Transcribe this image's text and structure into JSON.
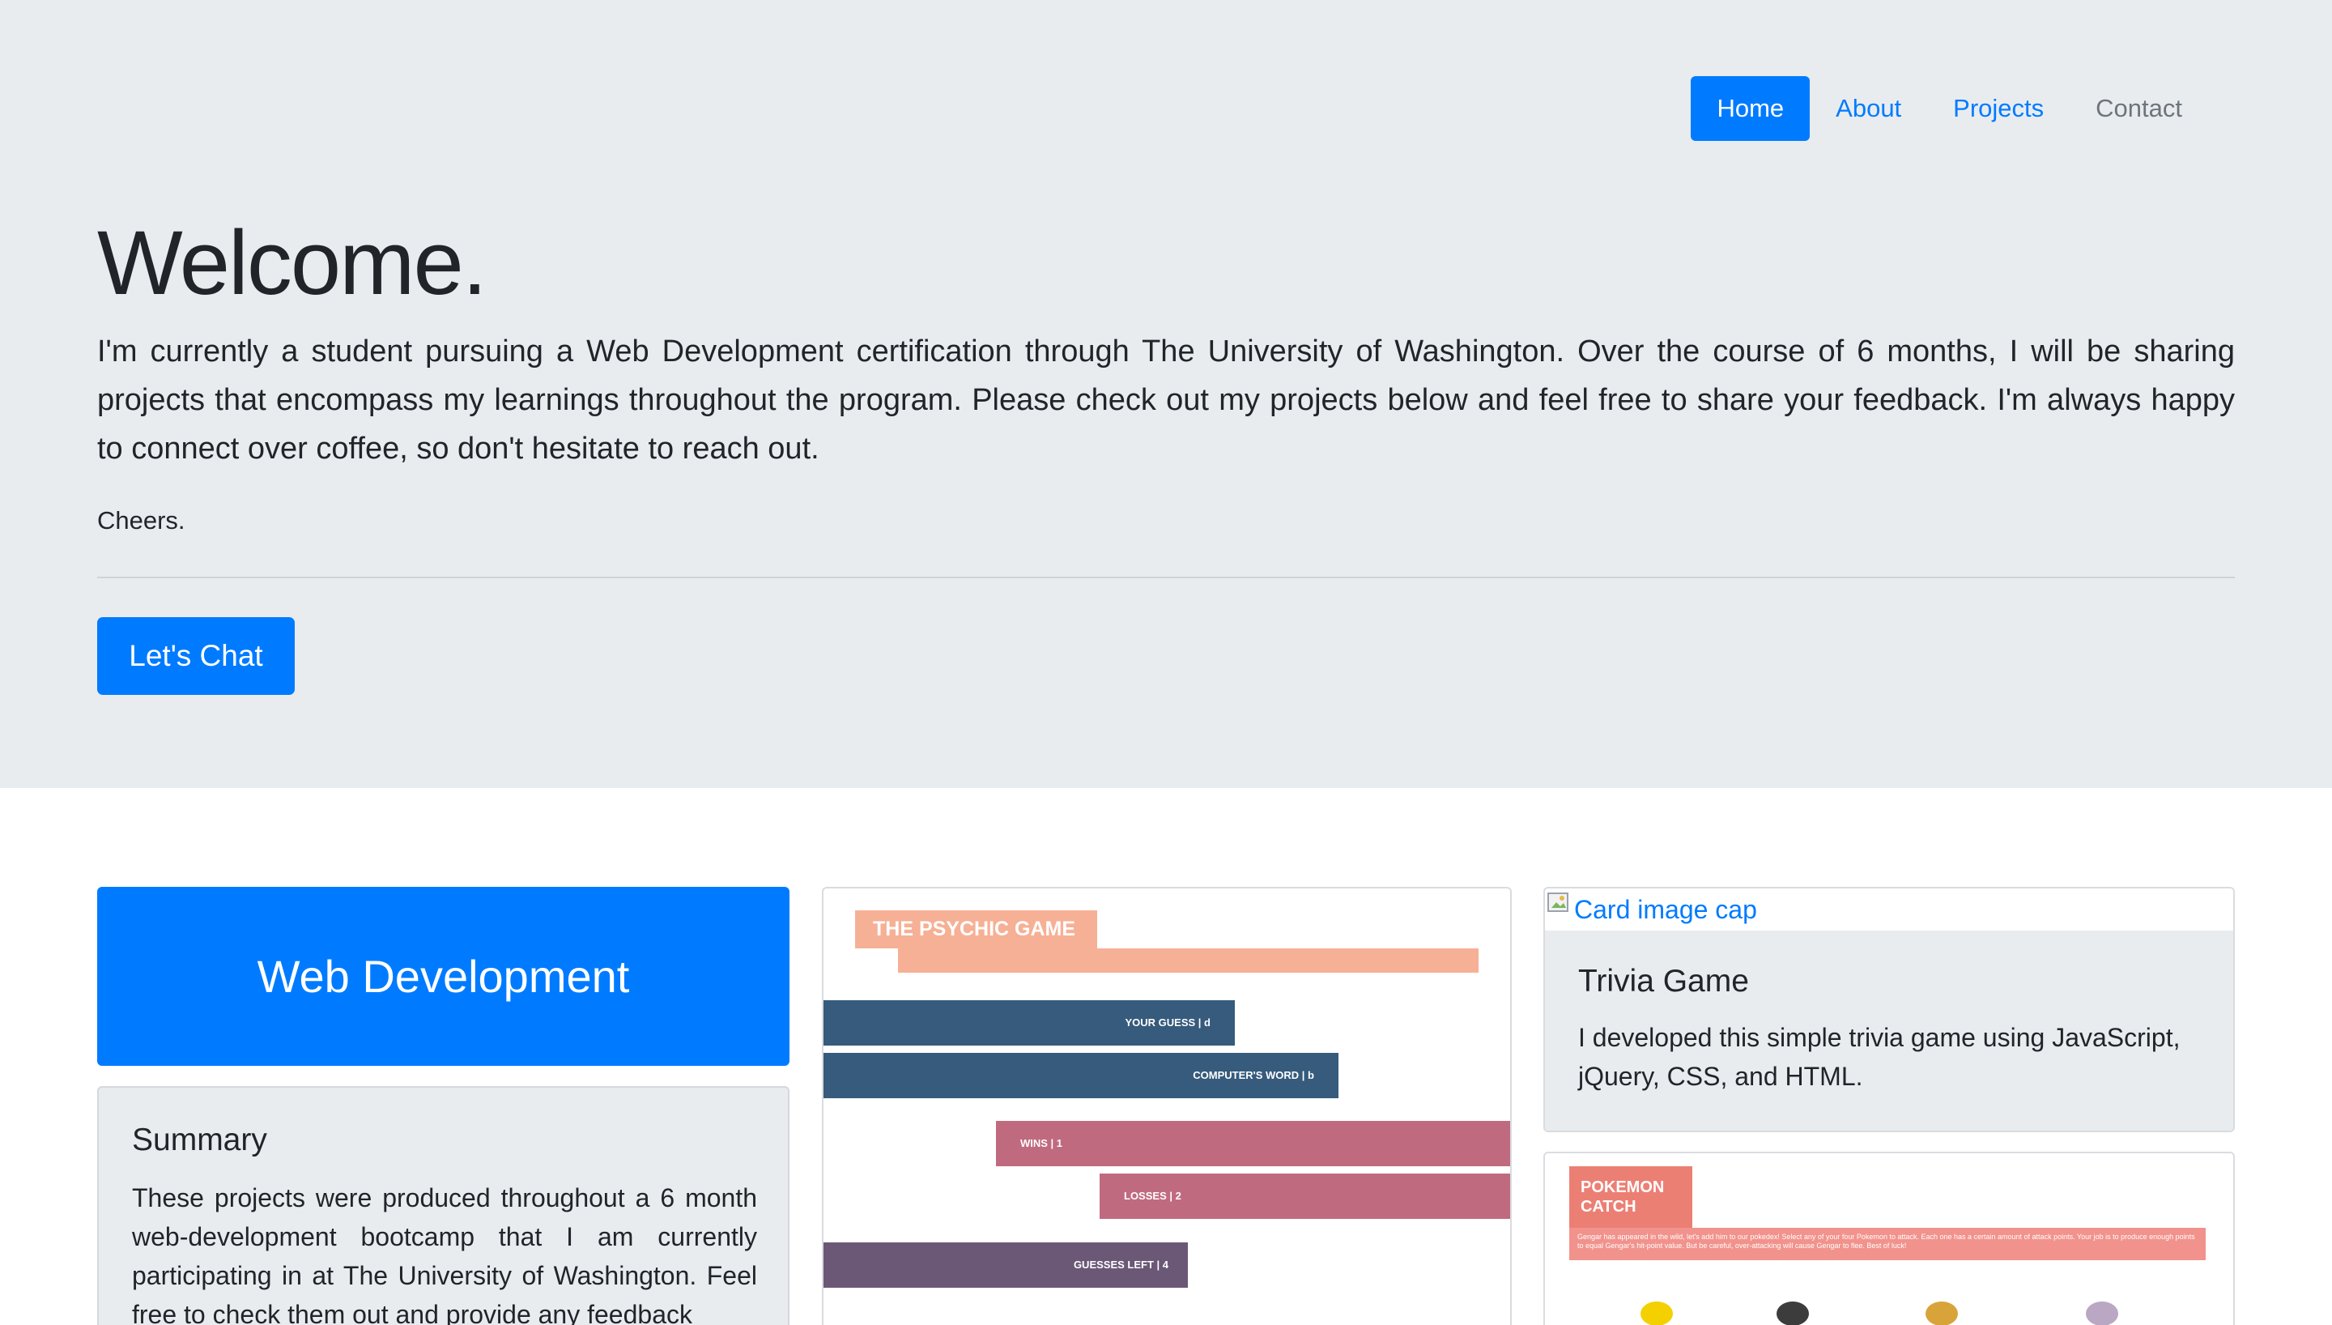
{
  "nav": {
    "items": [
      {
        "label": "Home",
        "active": true
      },
      {
        "label": "About"
      },
      {
        "label": "Projects"
      },
      {
        "label": "Contact"
      }
    ]
  },
  "hero": {
    "heading": "Welcome.",
    "lead": "I'm currently a student pursuing a Web Development certification through The University of Washington. Over the course of 6 months, I will be sharing projects that encompass my learnings throughout the program. Please check out my projects below and feel free to share your feedback. I'm always happy to connect over coffee, so don't hesitate to reach out.",
    "signoff": "Cheers.",
    "cta_label": "Let's Chat"
  },
  "web_dev_card": {
    "title": "Web Development"
  },
  "summary_card": {
    "title": "Summary",
    "text": "These projects were produced throughout a 6 month web-development bootcamp that I am currently participating in at The University of Washington. Feel free to check them out and provide any feedback"
  },
  "psychic_game": {
    "title": "THE PSYCHIC GAME",
    "rows": {
      "your_guess": "YOUR GUESS | d",
      "computer_word": "COMPUTER'S WORD | b",
      "wins": "WINS | 1",
      "losses": "LOSSES | 2",
      "guesses_left": "GUESSES LEFT | 4"
    }
  },
  "trivia_card": {
    "image_alt": "Card image cap",
    "title": "Trivia Game",
    "text": "I developed this simple trivia game using JavaScript, jQuery, CSS, and HTML."
  },
  "pokemon_card": {
    "title": "POKEMON CATCH",
    "description": "Gengar has appeared in the wild, let's add him to our pokedex! Select any of your four Pokemon to attack. Each one has a certain amount of attack points. Your job is to produce enough points to equal Gengar's hit-point value. But be careful, over-attacking will cause Gengar to flee. Best of luck!"
  },
  "colors": {
    "primary": "#007bff",
    "jumbotron_bg": "#e9ecef",
    "muted": "#6c757d"
  }
}
